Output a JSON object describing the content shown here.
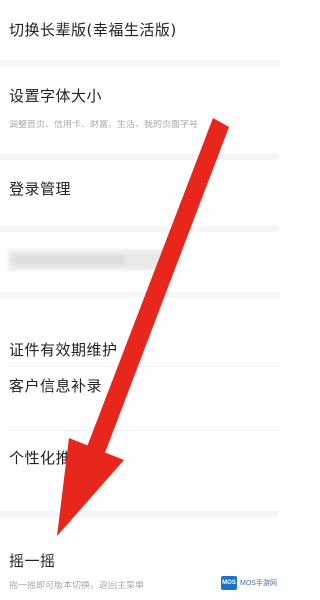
{
  "settings": {
    "items": [
      {
        "title": "切换长辈版(幸福生活版)",
        "subtitle": ""
      },
      {
        "title": "设置字体大小",
        "subtitle": "调整首页、信用卡、财富、生活、我的页面字号"
      },
      {
        "title": "登录管理",
        "subtitle": ""
      },
      {
        "title": "证件有效期维护",
        "subtitle": ""
      },
      {
        "title": "客户信息补录",
        "subtitle": ""
      },
      {
        "title": "个性化推荐",
        "subtitle": ""
      },
      {
        "title": "摇一摇",
        "subtitle": "摇一摇即可版本切换，返回主菜单"
      }
    ]
  },
  "overlay": {
    "arrow_color": "#e8261c",
    "arrow_target": "摇一摇"
  },
  "watermark": {
    "logo_text": "MOS",
    "text": "MOS手游网"
  }
}
